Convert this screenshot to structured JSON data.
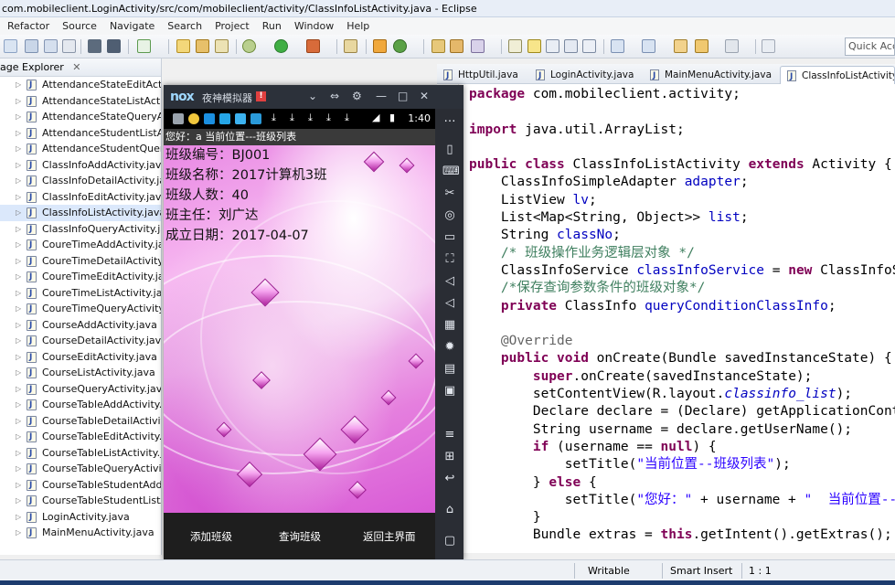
{
  "window": {
    "title": "com.mobileclient.LoginActivity/src/com/mobileclient/activity/ClassInfoListActivity.java - Eclipse"
  },
  "menu": [
    "Refactor",
    "Source",
    "Navigate",
    "Search",
    "Project",
    "Run",
    "Window",
    "Help"
  ],
  "toolbar": {
    "quick_access": "Quick Acc"
  },
  "package_explorer": {
    "title": "age Explorer",
    "close": "✕",
    "items": [
      "AttendanceStateEditActivity",
      "AttendanceStateListActivity",
      "AttendanceStateQueryActivity",
      "AttendanceStudentListActivity",
      "AttendanceStudentQueryActivity",
      "ClassInfoAddActivity.java",
      "ClassInfoDetailActivity.java",
      "ClassInfoEditActivity.java",
      "ClassInfoListActivity.java",
      "ClassInfoQueryActivity.java",
      "CoureTimeAddActivity.java",
      "CoureTimeDetailActivity.java",
      "CoureTimeEditActivity.java",
      "CoureTimeListActivity.java",
      "CoureTimeQueryActivity.java",
      "CourseAddActivity.java",
      "CourseDetailActivity.java",
      "CourseEditActivity.java",
      "CourseListActivity.java",
      "CourseQueryActivity.java",
      "CourseTableAddActivity.java",
      "CourseTableDetailActivity.j",
      "CourseTableEditActivity.java",
      "CourseTableListActivity.java",
      "CourseTableQueryActivity.",
      "CourseTableStudentAddAc",
      "CourseTableStudentListAct",
      "LoginActivity.java",
      "MainMenuActivity.java"
    ]
  },
  "editor_tabs": [
    {
      "label": "HttpUtil.java"
    },
    {
      "label": "LoginActivity.java"
    },
    {
      "label": "MainMenuActivity.java"
    },
    {
      "label": "ClassInfoListActivity.java"
    }
  ],
  "code": {
    "l1_kw": "package",
    "l1": " com.mobileclient.activity;",
    "l2_kw": "import",
    "l2": " java.util.ArrayList;",
    "l3_kw1": "public class",
    "l3_a": " ClassInfoListActivity ",
    "l3_kw2": "extends",
    "l3_b": " Activity {",
    "l4_a": "    ClassInfoSimpleAdapter ",
    "l4_f": "adapter",
    "l4_b": ";",
    "l5_a": "    ListView ",
    "l5_f": "lv",
    "l5_b": ";",
    "l6_a": "    List<Map<String, Object>> ",
    "l6_f": "list",
    "l6_b": ";",
    "l7_a": "    String ",
    "l7_f": "classNo",
    "l7_b": ";",
    "l8": "    /* 班级操作业务逻辑层对象 */",
    "l9_a": "    ClassInfoService ",
    "l9_f": "classInfoService",
    "l9_b": " = ",
    "l9_kw": "new",
    "l9_c": " ClassInfoS",
    "l10": "    /*保存查询参数条件的班级对象*/",
    "l11_kw": "    private",
    "l11_a": " ClassInfo ",
    "l11_f": "queryConditionClassInfo",
    "l11_b": ";",
    "l12": "",
    "l13": "    @Override",
    "l14_kw": "    public void",
    "l14_a": " onCreate(Bundle savedInstanceState) {",
    "l15_kw": "        super",
    "l15_a": ".onCreate(savedInstanceState);",
    "l16_a": "        setContentView(R.layout.",
    "l16_f": "classinfo_list",
    "l16_b": ");",
    "l17_a": "        Declare declare = (Declare) getApplicationCont",
    "l18_a": "        String username = declare.getUserName();",
    "l19_kw": "        if",
    "l19_a": " (username == ",
    "l19_kw2": "null",
    "l19_b": ") {",
    "l20_a": "            setTitle(",
    "l20_s": "\"当前位置--班级列表\"",
    "l20_b": ");",
    "l21_a": "        } ",
    "l21_kw": "else",
    "l21_b": " {",
    "l22_a": "            setTitle(",
    "l22_s": "\"您好：\"",
    "l22_b": " + username + ",
    "l22_s2": "\"  当前位置--",
    "l23": "        }",
    "l24_a": "        Bundle extras = ",
    "l24_kw": "this",
    "l24_b": ".getIntent().getExtras();"
  },
  "emulator": {
    "logo": "nox",
    "name": "夜神模拟器",
    "badge": "!",
    "time": "1:40",
    "app_title": "您好：a  当前位置---班级列表",
    "class_no": "班级编号：BJ001",
    "class_name": "班级名称：2017计算机3班",
    "class_count": "班级人数：40",
    "head_teacher": "班主任：刘广达",
    "founded": "成立日期：2017-04-07",
    "btn_add": "添加班级",
    "btn_query": "查询班级",
    "btn_back": "返回主界面"
  },
  "status": {
    "writable": "Writable",
    "insert": "Smart Insert",
    "pos": "1 : 1"
  },
  "colors": {
    "keyword": "#7f0055",
    "field": "#0000c0",
    "comment": "#3f7f5f",
    "string": "#2a00ff"
  }
}
